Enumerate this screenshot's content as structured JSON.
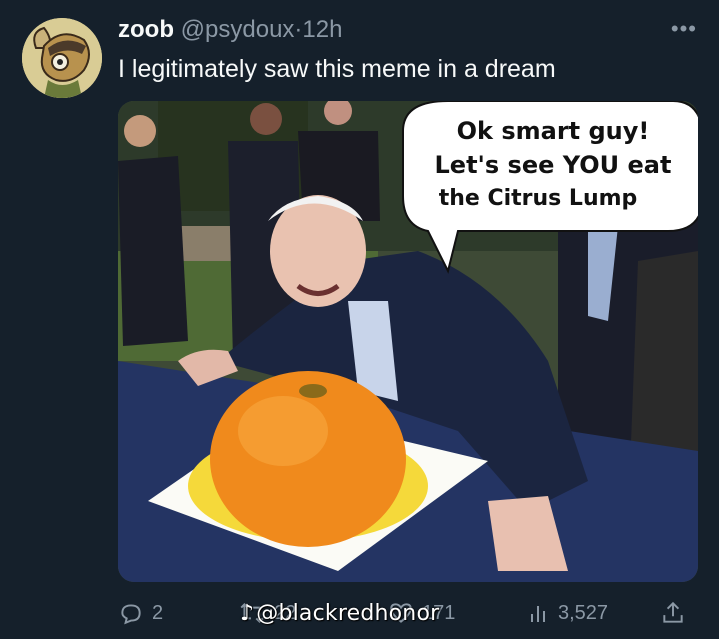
{
  "tweet": {
    "author_name": "zoob",
    "handle": "@psydoux",
    "separator": "·",
    "time": "12h",
    "more_icon": "more-horizontal-icon",
    "text": "I legitimately saw this meme in a dream"
  },
  "media": {
    "bubble_line1": "Ok smart guy!",
    "bubble_line2": "Let's see YOU eat",
    "bubble_line3": "the Citrus Lump",
    "watermark": "@blackredhonor",
    "watermark_icon": "tiktok-icon"
  },
  "actions": {
    "reply_count": "2",
    "repost_count": "22",
    "like_count": "171",
    "views_count": "3,527"
  },
  "colors": {
    "background": "#15202b",
    "primary_text": "#f7f9f9",
    "secondary_text": "#8b98a5"
  }
}
